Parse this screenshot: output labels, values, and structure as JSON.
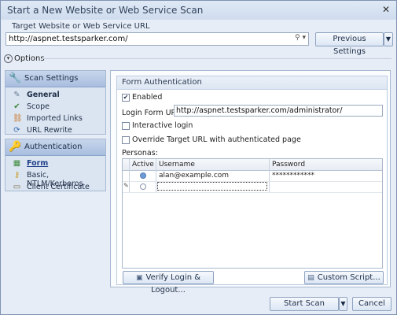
{
  "window": {
    "title": "Start a New Website or Web Service Scan"
  },
  "target": {
    "label": "Target Website or Web Service URL",
    "url": "http://aspnet.testsparker.com/",
    "previous_settings_label": "Previous Settings"
  },
  "options": {
    "label": "Options"
  },
  "sidebar": {
    "groups": [
      {
        "title": "Scan Settings",
        "items": [
          {
            "label": "General",
            "icon": "wrench-icon"
          },
          {
            "label": "Scope",
            "icon": "scope-icon"
          },
          {
            "label": "Imported Links",
            "icon": "link-icon"
          },
          {
            "label": "URL Rewrite",
            "icon": "rewrite-icon"
          }
        ]
      },
      {
        "title": "Authentication",
        "items": [
          {
            "label": "Form",
            "icon": "form-icon"
          },
          {
            "label": "Basic, NTLM/Kerberos",
            "icon": "key-icon"
          },
          {
            "label": "Client Certificate",
            "icon": "certificate-icon"
          }
        ]
      }
    ]
  },
  "form_auth": {
    "title": "Form Authentication",
    "enabled_label": "Enabled",
    "enabled": true,
    "login_form_url_label": "Login Form URL:",
    "login_form_url": "http://aspnet.testsparker.com/administrator/",
    "interactive_login_label": "Interactive login",
    "interactive_login": false,
    "override_label": "Override Target URL with authenticated page",
    "override": false,
    "personas_label": "Personas:",
    "columns": [
      "Active",
      "Username",
      "Password"
    ],
    "rows": [
      {
        "active": true,
        "username": "alan@example.com",
        "password": "************"
      },
      {
        "active": false,
        "username": "",
        "password": ""
      }
    ],
    "verify_label": "Verify Login & Logout...",
    "custom_script_label": "Custom Script..."
  },
  "footer": {
    "start_label": "Start Scan",
    "cancel_label": "Cancel"
  }
}
